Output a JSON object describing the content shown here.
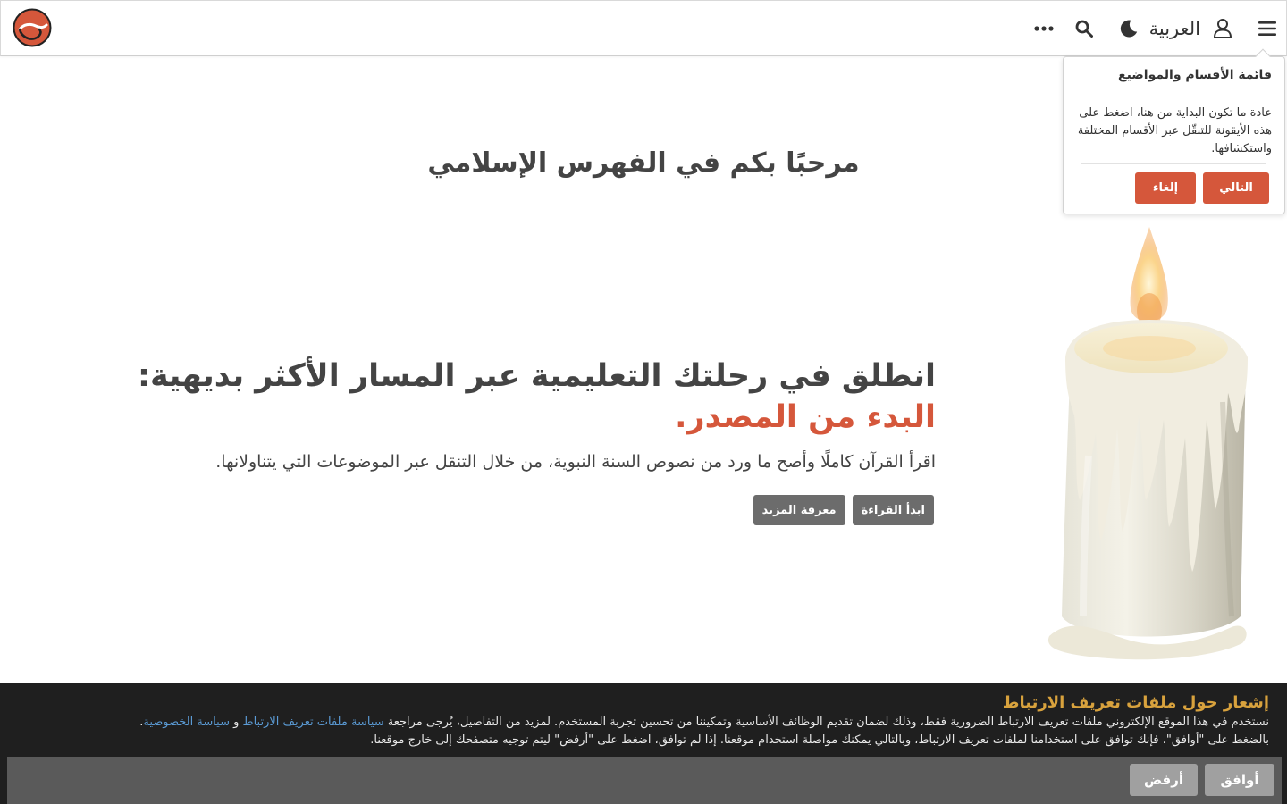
{
  "header": {
    "menu_icon": "hamburger-icon",
    "user_icon": "user-icon",
    "language": "العربية",
    "theme_icon": "moon-icon",
    "search_icon": "search-icon",
    "more_icon": "ellipsis-icon",
    "logo_icon": "site-logo-icon"
  },
  "welcome": {
    "title": "مرحبًا بكم في الفهرس الإسلامي"
  },
  "hero": {
    "title_main": "انطلق في رحلتك التعليمية عبر المسار الأكثر بديهية: ",
    "title_accent": "البدء من المصدر.",
    "subtitle": "اقرأ القرآن كاملًا وأصح ما ورد من نصوص السنة النبوية، من خلال التنقل عبر الموضوعات التي يتناولانها.",
    "start_button": "ابدأ القراءة",
    "learn_button": "معرفة المزيد"
  },
  "popover": {
    "title": "قائمة الأقسام والمواضيع",
    "body": "عادة ما تكون البداية من هنا، اضغط على هذه الأيقونة للتنقّل عبر الأقسام المختلفة واستكشافها.",
    "next_button": "التالي",
    "cancel_button": "إلغاء"
  },
  "cookie": {
    "title": "إشعار حول ملفات تعريف الارتباط",
    "text_1": "نستخدم في هذا الموقع الإلكتروني ملفات تعريف الارتباط الضرورية فقط، وذلك لضمان تقديم الوظائف الأساسية وتمكيننا من تحسين تجربة المستخدم. لمزيد من التفاصيل، يُرجى مراجعة ",
    "cookie_policy_link": "سياسة ملفات تعريف الارتباط",
    "and": " و ",
    "privacy_link": "سياسة الخصوصية",
    "period": ".",
    "text_2": "بالضغط على \"أوافق\"، فإنك توافق على استخدامنا لملفات تعريف الارتباط، وبالتالي يمكنك مواصلة استخدام موقعنا. إذا لم توافق، اضغط على \"أرفض\" ليتم توجيه متصفحك إلى خارج موقعنا.",
    "accept_button": "أوافق",
    "reject_button": "أرفض"
  },
  "colors": {
    "accent": "#d5573b",
    "cookie_title": "#d8a23d",
    "link": "#5b9bd5"
  }
}
